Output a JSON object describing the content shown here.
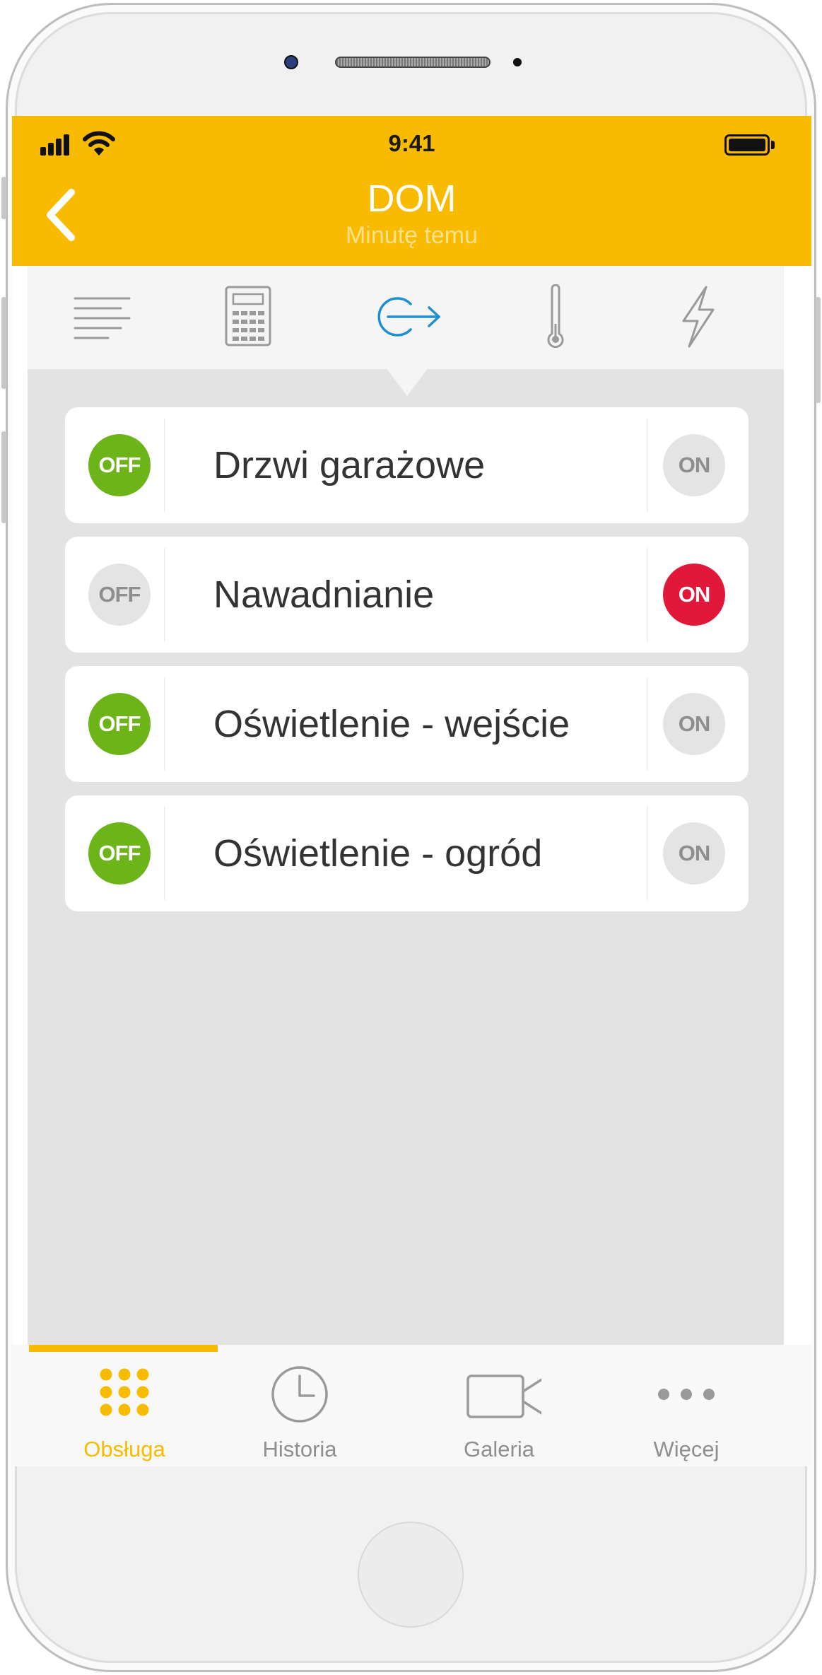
{
  "status_bar": {
    "time": "9:41"
  },
  "header": {
    "title": "DOM",
    "subtitle": "Minutę temu"
  },
  "top_tabs": [
    {
      "icon": "list-lines-icon",
      "active": false
    },
    {
      "icon": "keypad-icon",
      "active": true,
      "active_placeholder": false
    },
    {
      "icon": "output-arrow-icon",
      "active": true
    },
    {
      "icon": "thermometer-icon",
      "active": false
    },
    {
      "icon": "lightning-icon",
      "active": false
    }
  ],
  "outputs": [
    {
      "label": "Drzwi garażowe",
      "off_label": "OFF",
      "on_label": "ON",
      "state": "off"
    },
    {
      "label": "Nawadnianie",
      "off_label": "OFF",
      "on_label": "ON",
      "state": "on"
    },
    {
      "label": "Oświetlenie - wejście",
      "off_label": "OFF",
      "on_label": "ON",
      "state": "off"
    },
    {
      "label": "Oświetlenie - ogród",
      "off_label": "OFF",
      "on_label": "ON",
      "state": "off"
    }
  ],
  "bottom_nav": [
    {
      "label": "Obsługa",
      "icon": "grid-dots-icon",
      "active": true
    },
    {
      "label": "Historia",
      "icon": "clock-icon",
      "active": false
    },
    {
      "label": "Galeria",
      "icon": "video-camera-icon",
      "active": false
    },
    {
      "label": "Więcej",
      "icon": "more-dots-icon",
      "active": false
    }
  ],
  "colors": {
    "accent": "#f9bb00",
    "on_active": "#e2183a",
    "off_active": "#6cb418",
    "inactive": "#e4e4e4",
    "tab_active": "#1e8fd0"
  }
}
